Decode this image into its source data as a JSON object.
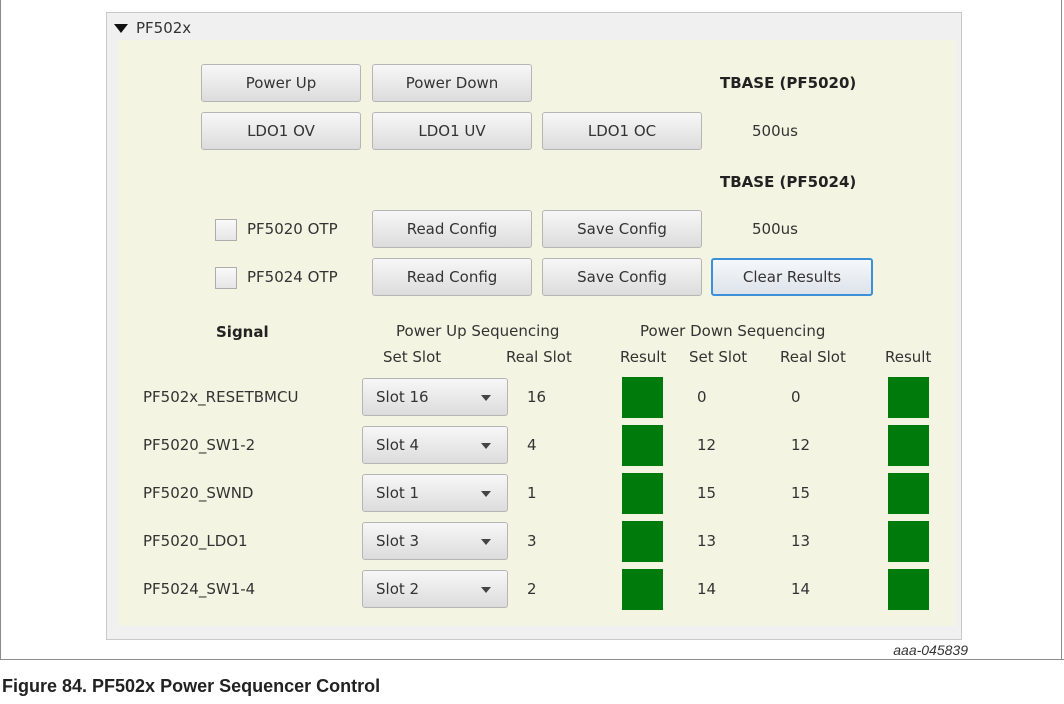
{
  "panel": {
    "title": "PF502x",
    "expanded": true
  },
  "buttons": {
    "power_up": "Power Up",
    "power_down": "Power Down",
    "ldo1_ov": "LDO1 OV",
    "ldo1_uv": "LDO1 UV",
    "ldo1_oc": "LDO1 OC",
    "read_config": "Read Config",
    "save_config": "Save Config",
    "clear_results": "Clear Results"
  },
  "tbase": {
    "pf5020_label": "TBASE (PF5020)",
    "pf5020_value": "500us",
    "pf5024_label": "TBASE (PF5024)",
    "pf5024_value": "500us"
  },
  "otp": {
    "pf5020": {
      "label": "PF5020 OTP",
      "checked": false
    },
    "pf5024": {
      "label": "PF5024 OTP",
      "checked": false
    }
  },
  "table": {
    "signal_header": "Signal",
    "power_up_header": "Power Up Sequencing",
    "power_down_header": "Power Down Sequencing",
    "set_slot_header": "Set Slot",
    "real_slot_header": "Real Slot",
    "result_header": "Result",
    "rows": [
      {
        "signal": "PF502x_RESETBMCU",
        "set_slot": "Slot 16",
        "real_slot": "16",
        "pd_set_slot": "0",
        "pd_real_slot": "0",
        "pu_result": "#007a0a",
        "pd_result": "#007a0a"
      },
      {
        "signal": "PF5020_SW1-2",
        "set_slot": "Slot 4",
        "real_slot": "4",
        "pd_set_slot": "12",
        "pd_real_slot": "12",
        "pu_result": "#007a0a",
        "pd_result": "#007a0a"
      },
      {
        "signal": "PF5020_SWND",
        "set_slot": "Slot 1",
        "real_slot": "1",
        "pd_set_slot": "15",
        "pd_real_slot": "15",
        "pu_result": "#007a0a",
        "pd_result": "#007a0a"
      },
      {
        "signal": "PF5020_LDO1",
        "set_slot": "Slot 3",
        "real_slot": "3",
        "pd_set_slot": "13",
        "pd_real_slot": "13",
        "pu_result": "#007a0a",
        "pd_result": "#007a0a"
      },
      {
        "signal": "PF5024_SW1-4",
        "set_slot": "Slot 2",
        "real_slot": "2",
        "pd_set_slot": "14",
        "pd_real_slot": "14",
        "pu_result": "#007a0a",
        "pd_result": "#007a0a"
      }
    ]
  },
  "watermark": "aaa-045839",
  "caption": "Figure 84.  PF502x Power Sequencer Control",
  "colors": {
    "panel_bg": "#f4f4e2",
    "result_ok": "#007a0a",
    "focus": "#3c8fd8"
  }
}
